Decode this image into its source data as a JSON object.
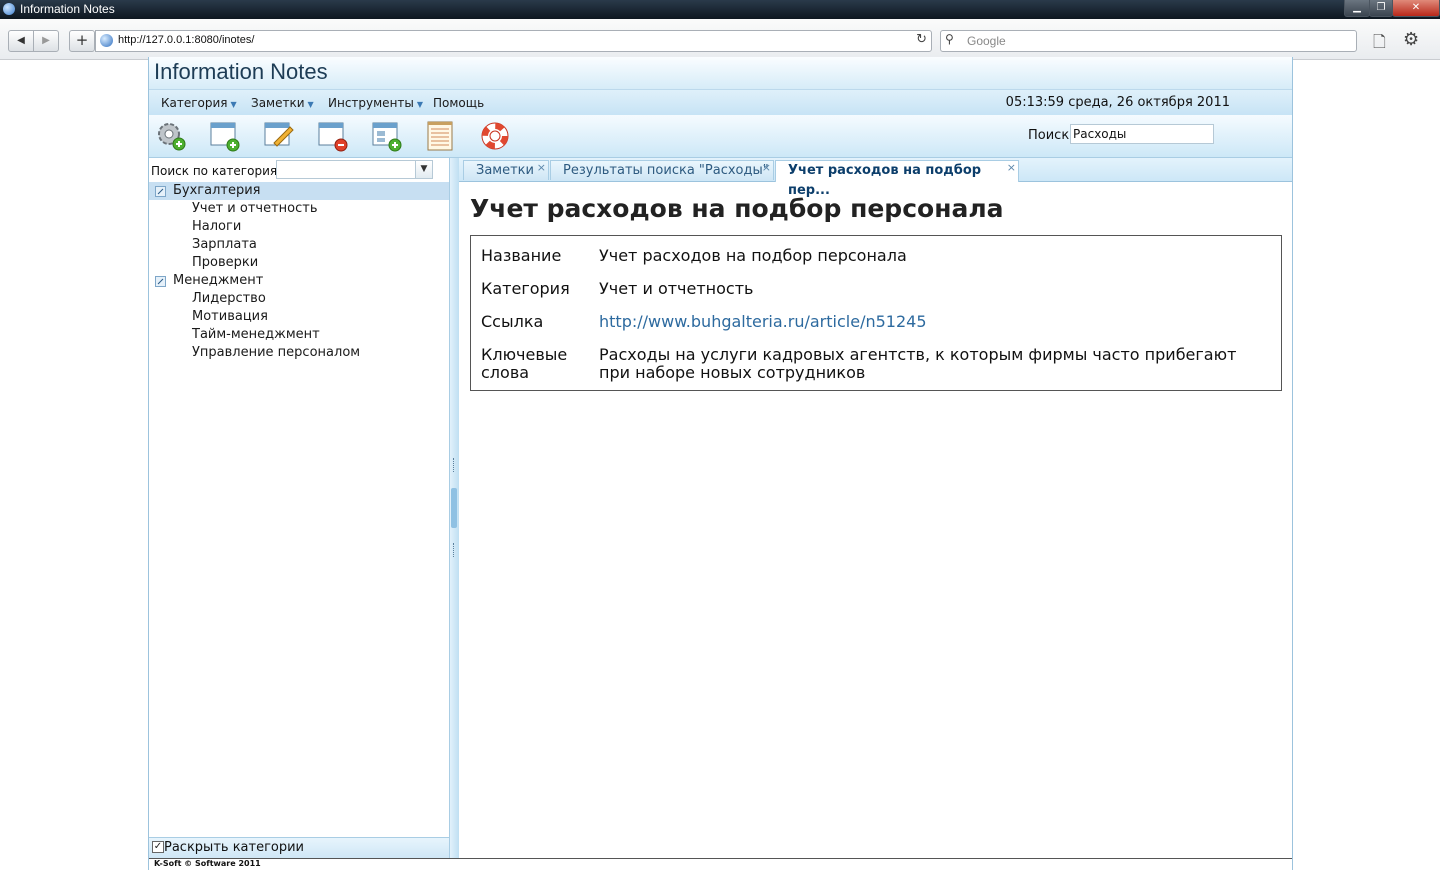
{
  "window": {
    "title": "Information Notes",
    "minimize_glyph": "▁",
    "maximize_glyph": "❐",
    "close_glyph": "✕"
  },
  "browser": {
    "url": "http://127.0.0.1:8080/inotes/",
    "search_placeholder": "Google",
    "back_glyph": "◀",
    "forward_glyph": "▶",
    "new_tab_glyph": "+",
    "reload_glyph": "↻",
    "search_glyph": "⚲",
    "page_glyph": "🗋",
    "tools_glyph": "⚙"
  },
  "app": {
    "brand": "Information Notes",
    "menu": [
      {
        "label": "Категория",
        "has_dropdown": true
      },
      {
        "label": "Заметки",
        "has_dropdown": true
      },
      {
        "label": "Инструменты",
        "has_dropdown": true
      },
      {
        "label": "Помощь",
        "has_dropdown": false
      }
    ],
    "dropdown_arrow": "▼",
    "clock": "05:13:59 среда, 26 октября 2011",
    "toolbar_icons": [
      "settings-add-icon",
      "new-note-icon",
      "edit-note-icon",
      "delete-note-icon",
      "add-category-icon",
      "notepad-icon",
      "help-lifebuoy-icon"
    ],
    "search": {
      "label": "Поиск",
      "value": "Расходы"
    }
  },
  "sidebar": {
    "search_label": "Поиск по категориям",
    "combo_arrow": "▼",
    "tree": [
      {
        "label": "Бухгалтерия",
        "level": 0,
        "selected": true
      },
      {
        "label": "Учет и отчетность",
        "level": 1
      },
      {
        "label": "Налоги",
        "level": 1
      },
      {
        "label": "Зарплата",
        "level": 1
      },
      {
        "label": "Проверки",
        "level": 1
      },
      {
        "label": "Менеджмент",
        "level": 0
      },
      {
        "label": "Лидерство",
        "level": 1
      },
      {
        "label": "Мотивация",
        "level": 1
      },
      {
        "label": "Тайм-менеджмент",
        "level": 1
      },
      {
        "label": "Управление персоналом",
        "level": 1
      }
    ],
    "expand_checkbox": {
      "label": "Раскрыть категории",
      "checked": true,
      "mark": "✓"
    }
  },
  "tabs": [
    {
      "label": "Заметки",
      "active": false
    },
    {
      "label": "Результаты поиска \"Расходы\"",
      "active": false
    },
    {
      "label": "Учет расходов на подбор пер...",
      "active": true
    }
  ],
  "tab_close_glyph": "×",
  "note": {
    "title": "Учет расходов на подбор персонала",
    "fields": [
      {
        "label": "Название",
        "value": "Учет расходов на подбор персонала"
      },
      {
        "label": "Категория",
        "value": "Учет и отчетность"
      },
      {
        "label": "Ссылка",
        "value": "http://www.buhgalteria.ru/article/n51245"
      },
      {
        "label": "Ключевые слова",
        "value": "Расходы на услуги кадровых агентств, к которым фирмы часто прибегают при наборе новых сотрудников"
      }
    ]
  },
  "footer": {
    "copyright": "K-Soft © Software 2011"
  },
  "colors": {
    "accent": "#2d6a9f",
    "header_bg": "#d6ecf8",
    "selected_row": "#c7dff2"
  }
}
